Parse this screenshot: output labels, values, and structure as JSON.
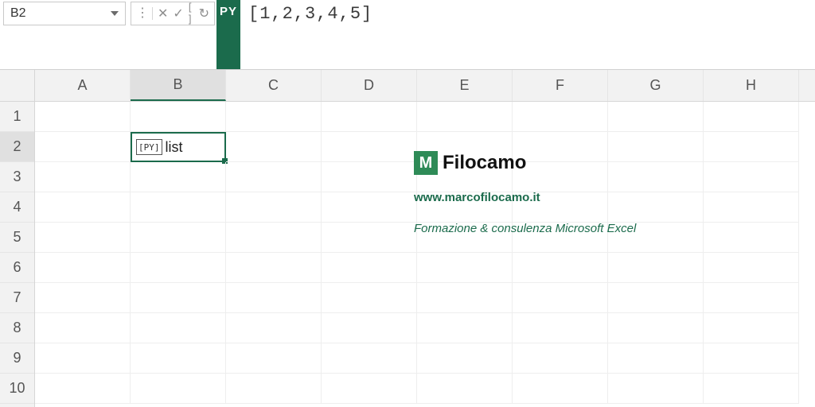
{
  "formulaBar": {
    "cellRef": "B2",
    "pyBadge": "PY",
    "formula": "[1,2,3,4,5]",
    "icons": {
      "menu": "⋮",
      "cancel": "✕",
      "confirm": "✓",
      "brackets": "[ ]",
      "cycle": "↻"
    }
  },
  "grid": {
    "columns": [
      "A",
      "B",
      "C",
      "D",
      "E",
      "F",
      "G",
      "H"
    ],
    "rowCount": 10,
    "activeCol": "B",
    "activeRow": 2,
    "selectedCell": {
      "ref": "B2",
      "chip": "PY",
      "value": "list"
    }
  },
  "overlay": {
    "logoLetter": "M",
    "brand": "Filocamo",
    "url": "www.marcofilocamo.it",
    "tagline": "Formazione & consulenza Microsoft Excel"
  }
}
